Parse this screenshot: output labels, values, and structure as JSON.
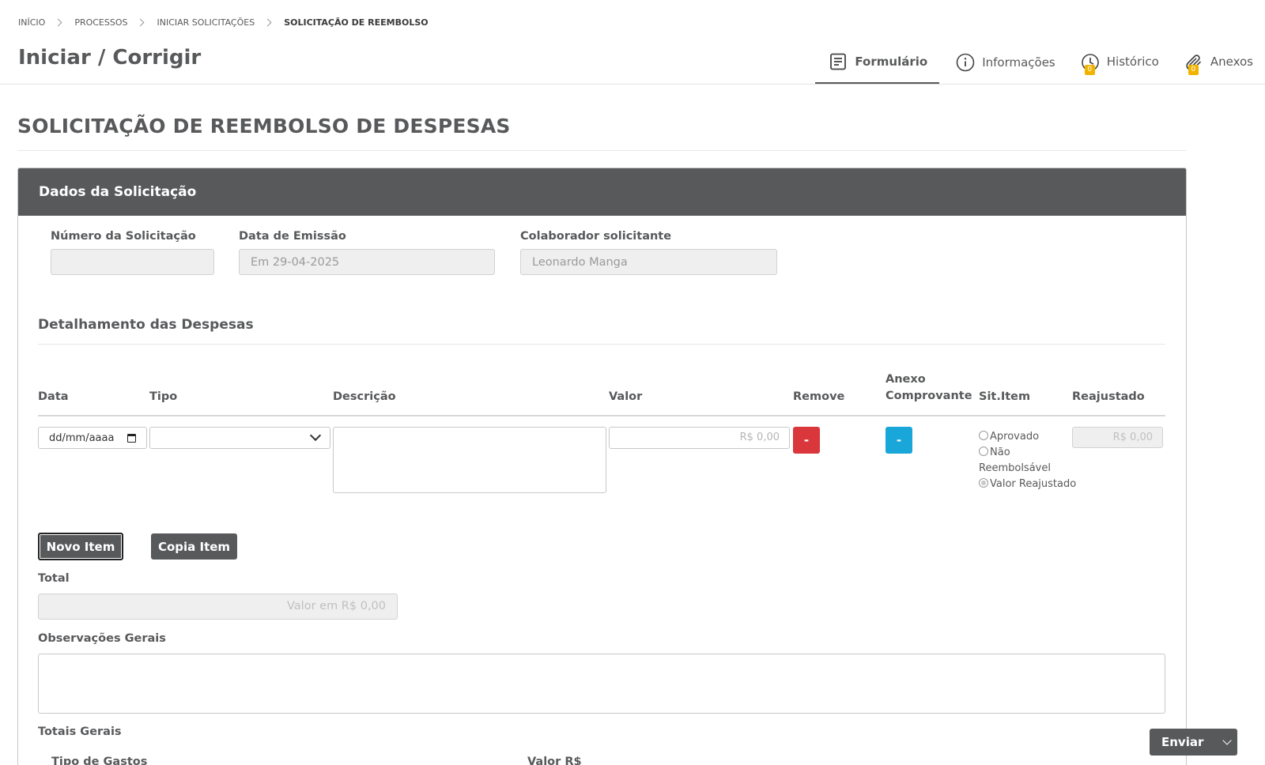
{
  "breadcrumb": {
    "items": [
      "INÍCIO",
      "PROCESSOS",
      "INICIAR SOLICITAÇÕES"
    ],
    "current": "SOLICITAÇÃO DE REEMBOLSO"
  },
  "page": {
    "title": "Iniciar / Corrigir"
  },
  "tabs": [
    {
      "label": "Formulário",
      "icon": "form-icon",
      "active": true
    },
    {
      "label": "Informações",
      "icon": "info-icon",
      "active": false
    },
    {
      "label": "Histórico",
      "icon": "clock-icon",
      "badge": "0",
      "active": false
    },
    {
      "label": "Anexos",
      "icon": "paperclip-icon",
      "badge": "0",
      "active": false
    }
  ],
  "form": {
    "title": "SOLICITAÇÃO DE REEMBOLSO DE DESPESAS",
    "panel_title": "Dados da Solicitação",
    "fields": {
      "numero": {
        "label": "Número da Solicitação",
        "value": ""
      },
      "data_emissao": {
        "label": "Data de Emissão",
        "value": "Em 29-04-2025"
      },
      "colaborador": {
        "label": "Colaborador solicitante",
        "value": "Leonardo Manga"
      }
    },
    "detalhamento": {
      "title": "Detalhamento das Despesas",
      "columns": {
        "data": "Data",
        "tipo": "Tipo",
        "descricao": "Descrição",
        "valor": "Valor",
        "remove": "Remove",
        "anexo_line1": "Anexo",
        "anexo_line2": "Comprovante",
        "sit_item": "Sit.Item",
        "reajustado": "Reajustado"
      },
      "row": {
        "date_placeholder": "dd/mm/aaaa",
        "tipo_value": "",
        "valor_placeholder": "R$ 0,00",
        "remove_label": "-",
        "anexo_label": "-",
        "sit_options": [
          "Aprovado",
          "Não Reembolsável",
          "Valor Reajustado"
        ],
        "sit_selected": "Valor Reajustado",
        "reajustado_placeholder": "R$ 0,00"
      }
    },
    "buttons": {
      "novo_item": "Novo Item",
      "copia_item": "Copia Item"
    },
    "total": {
      "label": "Total",
      "placeholder": "Valor em R$ 0,00"
    },
    "observacoes": {
      "label": "Observações Gerais",
      "value": ""
    },
    "totais_gerais": {
      "label": "Totais Gerais",
      "col_tipo": "Tipo de Gastos",
      "col_valor": "Valor R$"
    }
  },
  "actions": {
    "enviar": "Enviar"
  },
  "colors": {
    "primary_dark": "#58595b",
    "danger": "#d9373c",
    "info": "#19a6d8",
    "badge": "#f0b400"
  }
}
